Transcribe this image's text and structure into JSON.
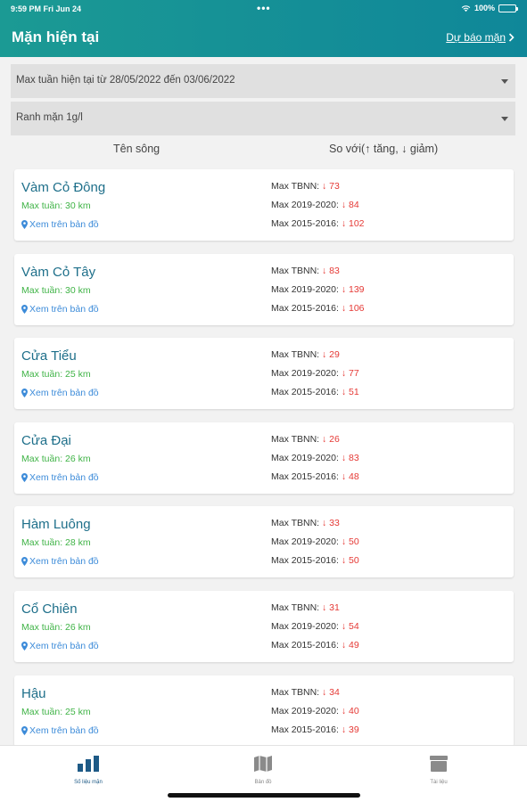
{
  "status": {
    "time": "9:59 PM   Fri Jun 24",
    "battery": "100%",
    "dots": "•••"
  },
  "header": {
    "title": "Mặn hiện tại",
    "forecast_link": "Dự báo mặn"
  },
  "filters": {
    "week_range": "Max tuần hiện tại từ 28/05/2022 đến 03/06/2022",
    "salinity_threshold": "Ranh mặn 1g/l"
  },
  "columns": {
    "river": "Tên sông",
    "compare": "So với(↑ tăng, ↓ giảm)"
  },
  "labels": {
    "map_link": "Xem trên bản đồ",
    "tbnn": "Max TBNN:",
    "y2019": "Max 2019-2020:",
    "y2015": "Max 2015-2016:"
  },
  "rivers": [
    {
      "name": "Vàm Cỏ Đông",
      "max_week": "Max tuần: 30 km",
      "tbnn": "↓ 73",
      "y2019": "↓ 84",
      "y2015": "↓ 102"
    },
    {
      "name": "Vàm Cỏ Tây",
      "max_week": "Max tuần: 30 km",
      "tbnn": "↓ 83",
      "y2019": "↓ 139",
      "y2015": "↓ 106"
    },
    {
      "name": "Cửa Tiểu",
      "max_week": "Max tuần: 25 km",
      "tbnn": "↓ 29",
      "y2019": "↓ 77",
      "y2015": "↓ 51"
    },
    {
      "name": "Cửa Đại",
      "max_week": "Max tuần: 26 km",
      "tbnn": "↓ 26",
      "y2019": "↓ 83",
      "y2015": "↓ 48"
    },
    {
      "name": "Hàm Luông",
      "max_week": "Max tuần: 28 km",
      "tbnn": "↓ 33",
      "y2019": "↓ 50",
      "y2015": "↓ 50"
    },
    {
      "name": "Cổ Chiên",
      "max_week": "Max tuần: 26 km",
      "tbnn": "↓ 31",
      "y2019": "↓ 54",
      "y2015": "↓ 49"
    },
    {
      "name": "Hậu",
      "max_week": "Max tuần: 25 km",
      "tbnn": "↓ 34",
      "y2019": "↓ 40",
      "y2015": "↓ 39"
    }
  ],
  "tabs": [
    {
      "label": "Số liệu mặn",
      "icon": "bar-chart-icon",
      "active": true
    },
    {
      "label": "Bản đồ",
      "icon": "map-icon",
      "active": false
    },
    {
      "label": "Tài liệu",
      "icon": "archive-icon",
      "active": false
    }
  ],
  "colors": {
    "header": "#148e97",
    "river_name": "#1e6f8a",
    "max_week": "#3fb346",
    "link": "#3c8bd9",
    "decrease": "#e53935",
    "tab_active": "#1e5a86"
  }
}
